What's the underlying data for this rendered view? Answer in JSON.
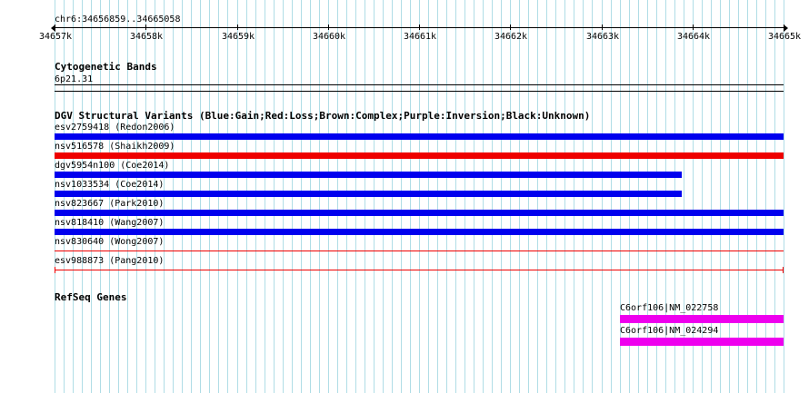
{
  "locus": "chr6:34656859..34665058",
  "ruler": {
    "ticks": [
      "34657k",
      "34658k",
      "34659k",
      "34660k",
      "34661k",
      "34662k",
      "34663k",
      "34664k",
      "34665k"
    ]
  },
  "cytobands": {
    "title": "Cytogenetic Bands",
    "band": "6p21.31"
  },
  "dgv": {
    "title": "DGV Structural Variants (Blue:Gain;Red:Loss;Brown:Complex;Purple:Inversion;Black:Unknown)",
    "colors": {
      "gain": "#0000ee",
      "loss": "#ee0000"
    },
    "variants": [
      {
        "label": "esv2759418 (Redon2006)",
        "type": "gain",
        "style": "bar",
        "end_fraction": 1.0
      },
      {
        "label": "nsv516578 (Shaikh2009)",
        "type": "loss",
        "style": "bar",
        "end_fraction": 1.0
      },
      {
        "label": "dgv5954n100 (Coe2014)",
        "type": "gain",
        "style": "bar",
        "end_fraction": 0.86
      },
      {
        "label": "nsv1033534 (Coe2014)",
        "type": "gain",
        "style": "bar",
        "end_fraction": 0.86
      },
      {
        "label": "nsv823667 (Park2010)",
        "type": "gain",
        "style": "bar",
        "end_fraction": 1.0
      },
      {
        "label": "nsv818410 (Wang2007)",
        "type": "gain",
        "style": "bar",
        "end_fraction": 1.0
      },
      {
        "label": "nsv830640 (Wong2007)",
        "type": "loss",
        "style": "line",
        "end_fraction": 1.0
      },
      {
        "label": "esv988873 (Pang2010)",
        "type": "loss",
        "style": "capped-line",
        "end_fraction": 1.0
      }
    ]
  },
  "refseq": {
    "title": "RefSeq Genes",
    "color": "#ee00ee",
    "genes": [
      {
        "label": "C6orf106|NM_022758",
        "start_fraction": 0.776
      },
      {
        "label": "C6orf106|NM_024294",
        "start_fraction": 0.776
      }
    ]
  },
  "gridlines": {
    "color": "#b0dde6"
  }
}
